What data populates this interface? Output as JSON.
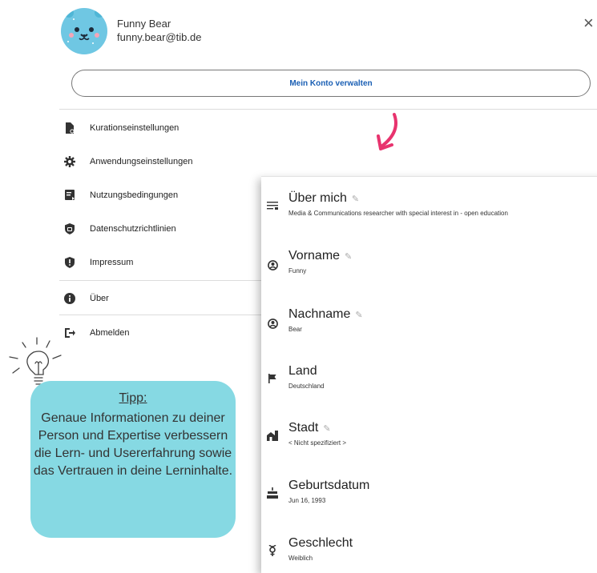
{
  "user": {
    "name": "Funny Bear",
    "email": "funny.bear@tib.de"
  },
  "header": {
    "close_symbol": "×",
    "account_button": "Mein Konto verwalten"
  },
  "menu": {
    "items": [
      {
        "label": "Kurationseinstellungen",
        "icon": "curation-file-icon"
      },
      {
        "label": "Anwendungseinstellungen",
        "icon": "gear-icon"
      },
      {
        "label": "Nutzungsbedingungen",
        "icon": "terms-document-icon"
      },
      {
        "label": "Datenschutzrichtlinien",
        "icon": "lock-icon"
      },
      {
        "label": "Impressum",
        "icon": "shield-icon"
      },
      {
        "label": "Über",
        "icon": "info-icon"
      },
      {
        "label": "Abmelden",
        "icon": "logout-icon"
      }
    ]
  },
  "profile": {
    "fields": [
      {
        "label": "Über mich",
        "value": "Media & Communications researcher with special interest in  - open education",
        "editable": true,
        "icon": "text-notes-icon"
      },
      {
        "label": "Vorname",
        "value": "Funny",
        "editable": true,
        "icon": "person-circle-icon"
      },
      {
        "label": "Nachname",
        "value": "Bear",
        "editable": true,
        "icon": "person-circle-icon"
      },
      {
        "label": "Land",
        "value": "Deutschland",
        "editable": false,
        "icon": "flag-icon"
      },
      {
        "label": "Stadt",
        "value": "< Nicht spezifiziert >",
        "editable": true,
        "icon": "city-icon"
      },
      {
        "label": "Geburtsdatum",
        "value": "Jun 16, 1993",
        "editable": false,
        "icon": "cake-icon"
      },
      {
        "label": "Geschlecht",
        "value": "Weiblich",
        "editable": false,
        "icon": "gender-icon"
      }
    ]
  },
  "tip": {
    "title": "Tipp:",
    "text": "Genaue Informationen zu deiner Person und Expertise verbessern die Lern- und Usererfahrung sowie das Vertrauen in deine Lerninhalte."
  },
  "colors": {
    "accent_blue": "#1a5fb4",
    "arrow_pink": "#e8336e",
    "tip_bg": "#86d9e3",
    "avatar_bg": "#6fc7e3"
  }
}
